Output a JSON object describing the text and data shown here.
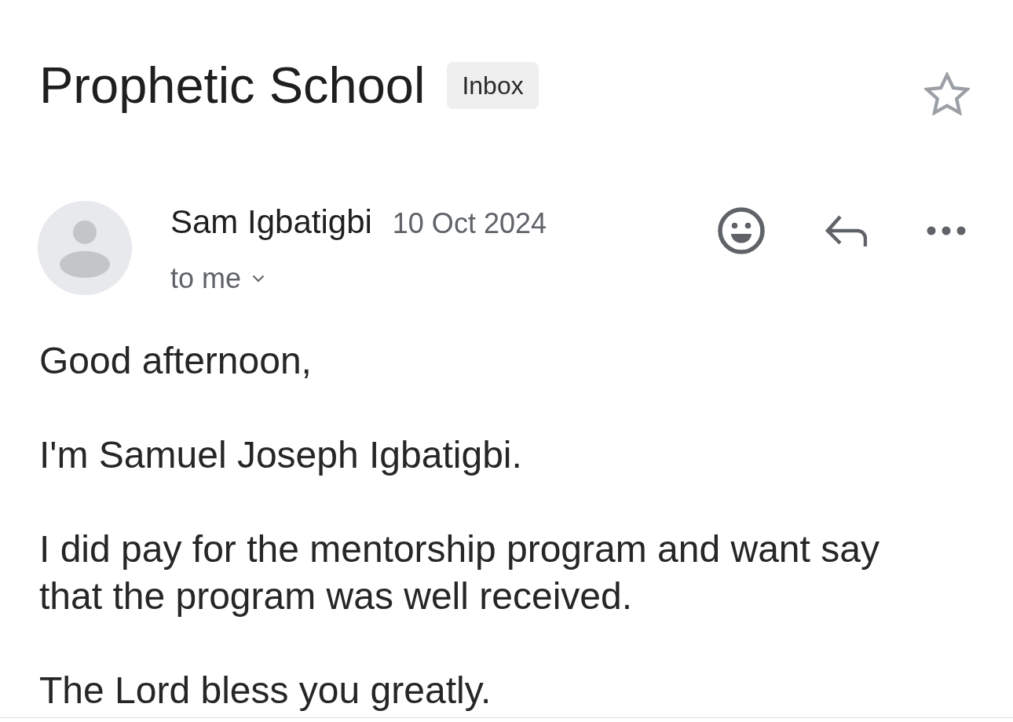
{
  "subject": "Prophetic School",
  "label": "Inbox",
  "starred": false,
  "message": {
    "sender": "Sam Igbatigbi",
    "date": "10 Oct 2024",
    "recipient": "to me",
    "body": [
      "Good afternoon,",
      "I'm Samuel Joseph Igbatigbi.",
      "I did pay for the mentorship program and want say that the program was well received.",
      "The Lord bless you greatly."
    ]
  }
}
